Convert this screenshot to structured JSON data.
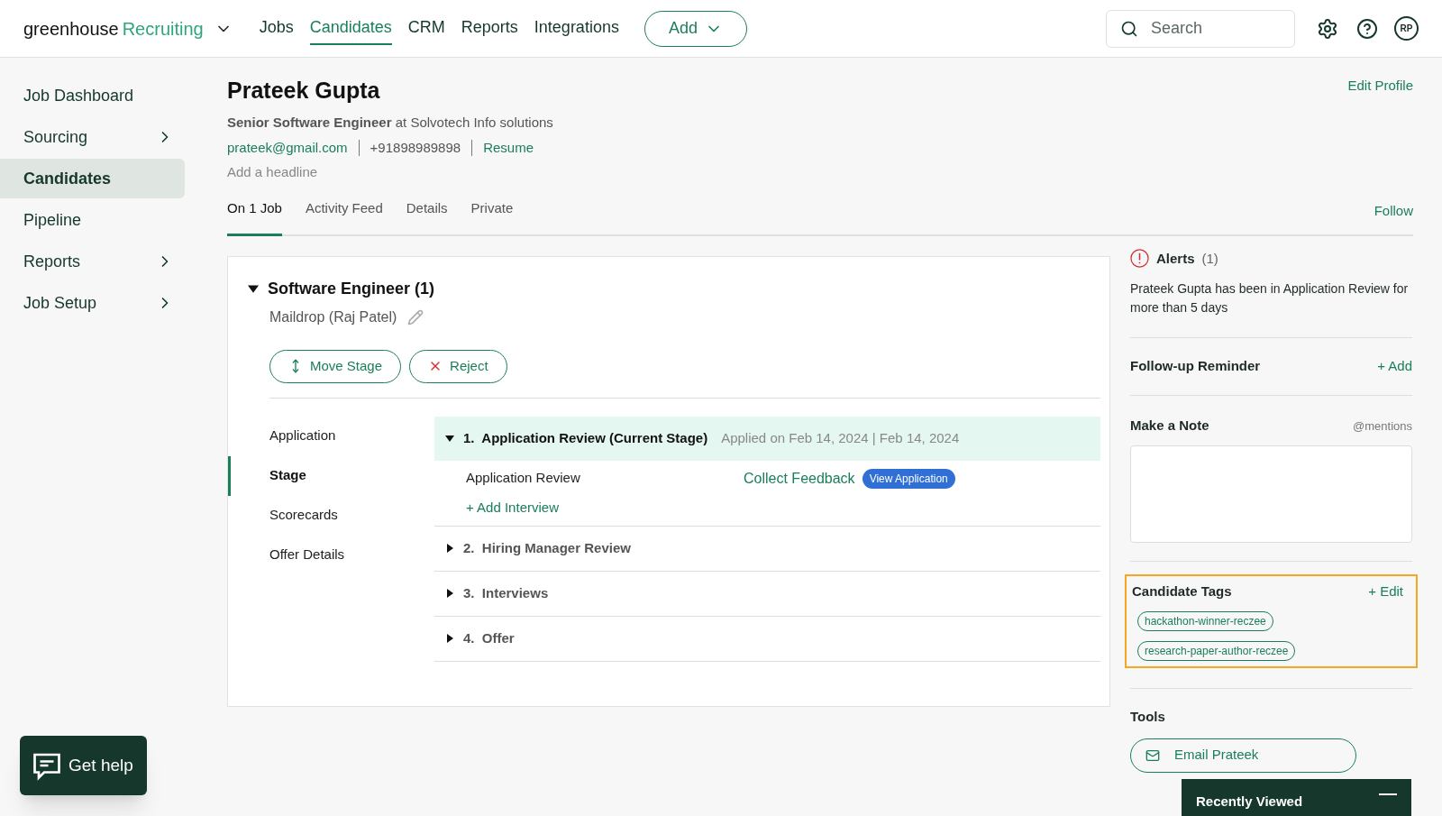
{
  "top_bar": {
    "logo": {
      "word": "greenhouse",
      "product": "Recruiting"
    },
    "nav": [
      {
        "label": "Jobs",
        "selected": false
      },
      {
        "label": "Candidates",
        "selected": true
      },
      {
        "label": "CRM",
        "selected": false
      },
      {
        "label": "Reports",
        "selected": false
      },
      {
        "label": "Integrations",
        "selected": false
      }
    ],
    "add_button": "Add",
    "search": {
      "placeholder": "Search"
    },
    "avatar": "RP"
  },
  "sidebar": {
    "items": [
      {
        "label": "Job Dashboard",
        "has_submenu": false,
        "selected": false
      },
      {
        "label": "Sourcing",
        "has_submenu": true,
        "selected": false
      },
      {
        "label": "Candidates",
        "has_submenu": false,
        "selected": true
      },
      {
        "label": "Pipeline",
        "has_submenu": false,
        "selected": false
      },
      {
        "label": "Reports",
        "has_submenu": true,
        "selected": false
      },
      {
        "label": "Job Setup",
        "has_submenu": true,
        "selected": false
      }
    ]
  },
  "profile": {
    "name": "Prateek Gupta",
    "headline": "**Senior Software Engineer** at Solvotech Info solutions",
    "email": "prateek@gmail.com",
    "phone": "+91898989898",
    "resume": "Resume",
    "add_headline": "Add a headline",
    "edit_profile": "Edit Profile",
    "follow": "Follow"
  },
  "tabs": [
    {
      "label": "On 1 Job",
      "selected": true
    },
    {
      "label": "Activity Feed",
      "selected": false
    },
    {
      "label": "Details",
      "selected": false
    },
    {
      "label": "Private",
      "selected": false
    }
  ],
  "job": {
    "title": "Software Engineer (1)",
    "expanded": true,
    "source": "Maildrop (Raj Patel)",
    "move_stage": "Move Stage",
    "reject": "Reject",
    "sections": [
      {
        "label": "Application",
        "selected": false
      },
      {
        "label": "Stage",
        "selected": true
      },
      {
        "label": "Scorecards",
        "selected": false
      },
      {
        "label": "Offer Details",
        "selected": false
      }
    ],
    "stages": [
      {
        "number": "1.",
        "title": "Application Review (Current Stage)",
        "note": "Applied on Feb 14, 2024 | Feb 14, 2024",
        "expanded": true,
        "current": true,
        "interview": {
          "name": "Application Review",
          "action": "Collect Feedback",
          "badge": "View Application"
        },
        "add_interview": "+ Add Interview"
      },
      {
        "number": "2.",
        "title": "Hiring Manager Review",
        "expanded": false,
        "current": false
      },
      {
        "number": "3.",
        "title": "Interviews",
        "expanded": false,
        "current": false
      },
      {
        "number": "4.",
        "title": "Offer",
        "expanded": false,
        "current": false
      }
    ]
  },
  "right_panel": {
    "alerts": {
      "title": "Alerts",
      "count": "(1)",
      "message": "Prateek Gupta has been in Application Review for more than 5 days"
    },
    "follow_up": {
      "title": "Follow-up Reminder",
      "action": "+ Add"
    },
    "note": {
      "title": "Make a Note",
      "hint": "@mentions"
    },
    "tags": {
      "title": "Candidate Tags",
      "action": "+ Edit",
      "highlighted": true,
      "items": [
        "hackathon-winner-reczee",
        "research-paper-author-reczee"
      ]
    },
    "tools": {
      "title": "Tools",
      "email_button": "Email Prateek"
    }
  },
  "get_help": "Get help",
  "recently_viewed": {
    "title": "Recently Viewed"
  }
}
